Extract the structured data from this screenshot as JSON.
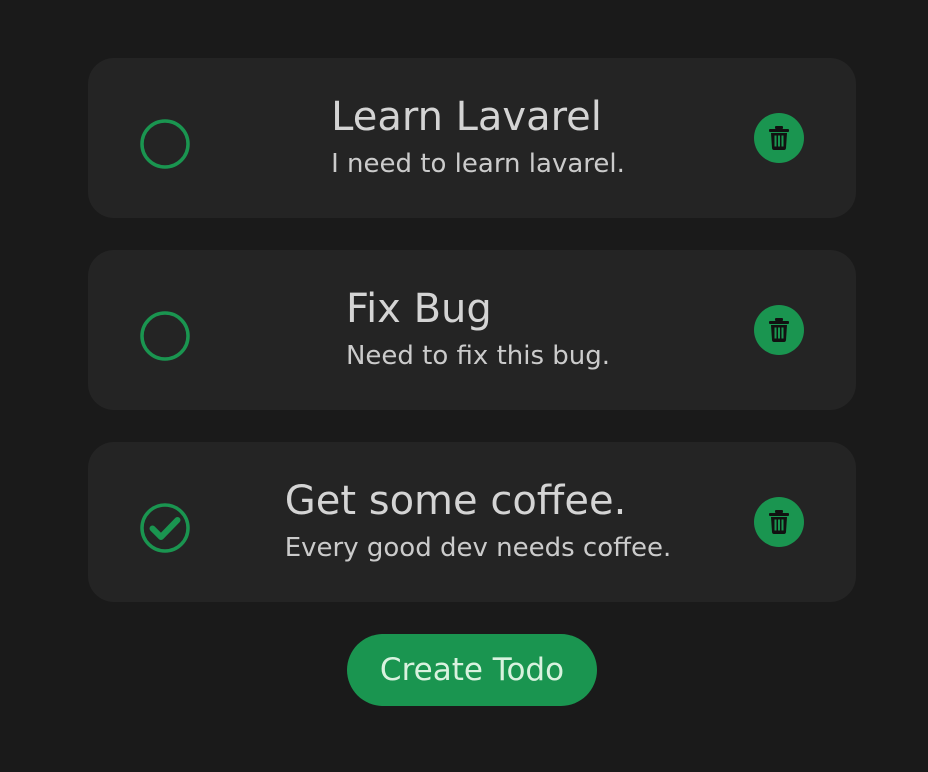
{
  "colors": {
    "background": "#1a1a1a",
    "card": "#242424",
    "accent": "#1a9550",
    "text": "#d4d4d4"
  },
  "todos": [
    {
      "title": "Learn Lavarel",
      "description": "I need to learn lavarel.",
      "completed": false,
      "status_icon": "circle-outline-icon",
      "delete_icon": "trash-icon"
    },
    {
      "title": "Fix Bug",
      "description": "Need to fix this bug.",
      "completed": false,
      "status_icon": "circle-outline-icon",
      "delete_icon": "trash-icon"
    },
    {
      "title": "Get some coffee.",
      "description": "Every good dev needs coffee.",
      "completed": true,
      "status_icon": "check-circle-icon",
      "delete_icon": "trash-icon"
    }
  ],
  "create_button": {
    "label": "Create Todo"
  }
}
